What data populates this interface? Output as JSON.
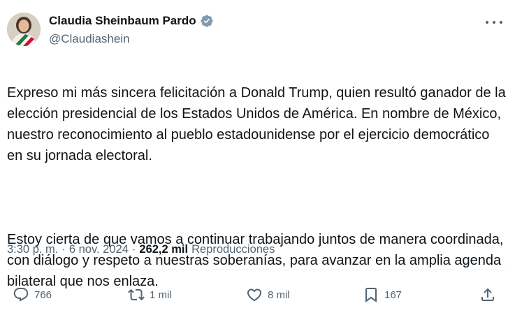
{
  "author": {
    "display_name": "Claudia Sheinbaum Pardo",
    "handle": "@Claudiashein",
    "verified_color": "#829aab"
  },
  "tweet": {
    "paragraph1": "Expreso mi más sincera felicitación a Donald Trump, quien resultó ganador de la elección presidencial de los Estados Unidos de América. En nombre de México, nuestro reconocimiento al pueblo estadounidense por el ejercicio democrático en su jornada electoral.",
    "paragraph2": "Estoy cierta de que vamos a continuar trabajando juntos de manera coordinada, con diálogo y respeto a nuestras soberanías, para avanzar en la amplia agenda bilateral que nos enlaza."
  },
  "meta": {
    "time": "3:30 p. m.",
    "separator": "·",
    "date": "6 nov. 2024",
    "views_count": "262,2 mil",
    "views_label": "Reproducciones"
  },
  "actions": {
    "replies": "766",
    "retweets": "1 mil",
    "likes": "8 mil",
    "bookmarks": "167"
  },
  "colors": {
    "text_primary": "#0f1419",
    "text_secondary": "#536471",
    "divider": "#eff3f4"
  },
  "icons": [
    "verified-badge-icon",
    "more-icon",
    "reply-icon",
    "retweet-icon",
    "like-icon",
    "bookmark-icon",
    "share-icon"
  ]
}
